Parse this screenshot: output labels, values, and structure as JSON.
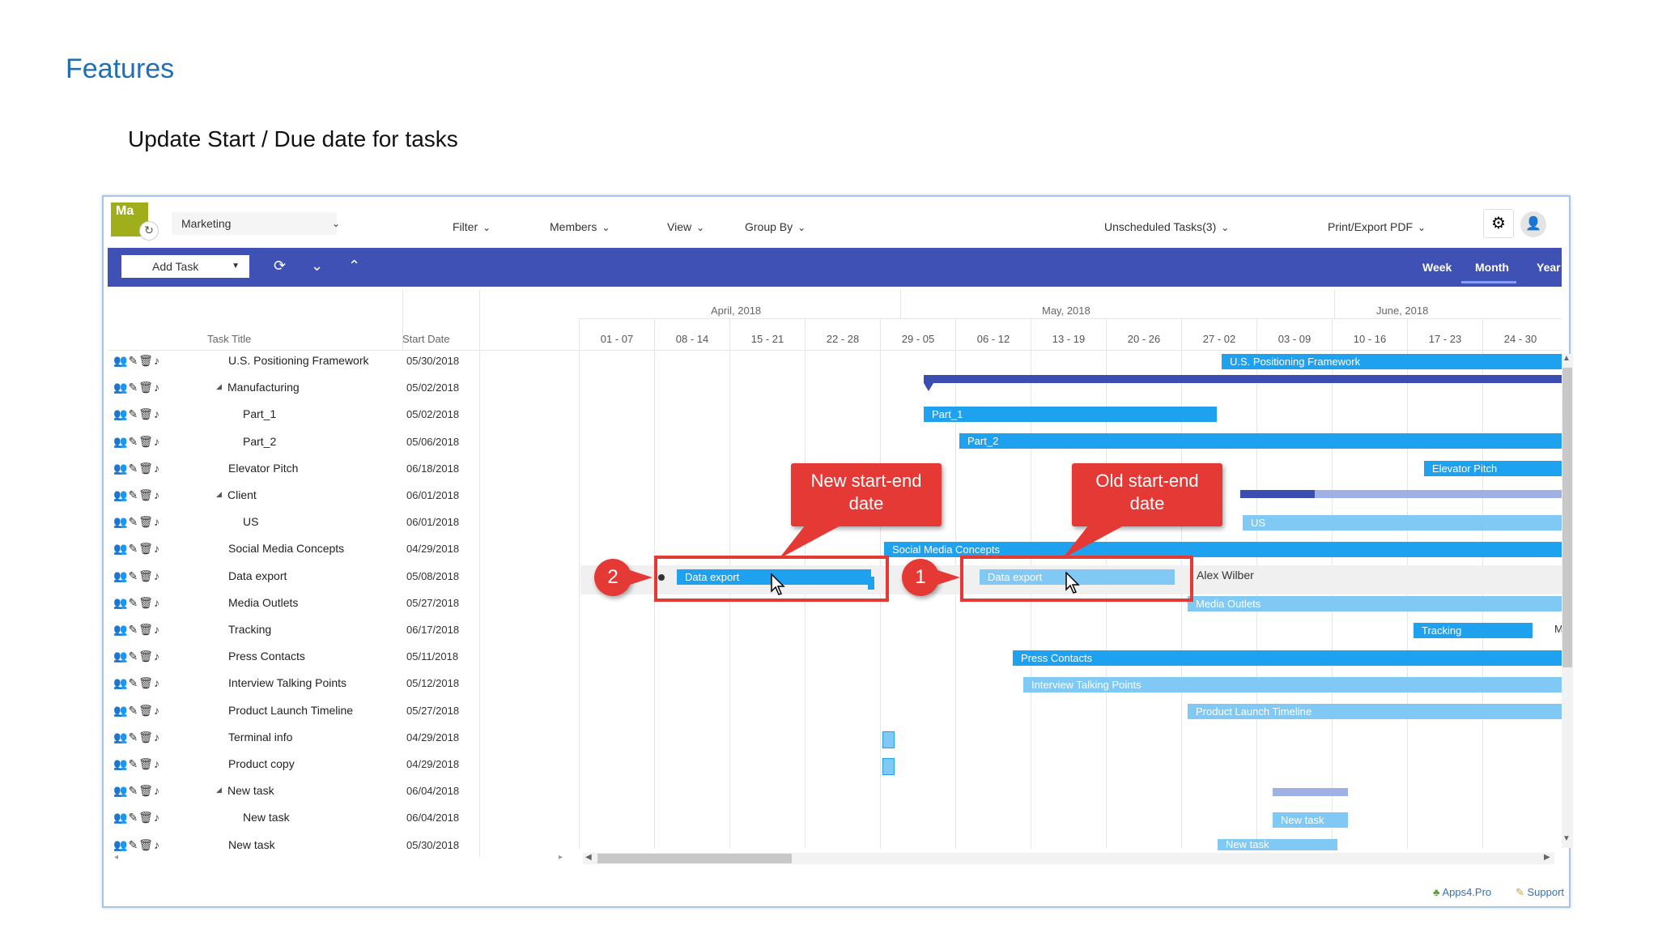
{
  "slide": {
    "title": "Features",
    "subtitle": "Update Start / Due date for tasks"
  },
  "app": {
    "logo_text": "Ma",
    "project": "Marketing",
    "toolbar": [
      "Filter",
      "Members",
      "View",
      "Group By"
    ],
    "unscheduled": "Unscheduled Tasks(3)",
    "print_export": "Print/Export PDF",
    "add_task": "Add Task",
    "views": [
      "Week",
      "Month",
      "Year"
    ],
    "active_view": "Month"
  },
  "grid": {
    "col_task_title": "Task Title",
    "col_start_date": "Start Date",
    "rows": [
      {
        "title": "U.S. Positioning Framework",
        "start": "05/30/2018",
        "indent": 0
      },
      {
        "title": "Manufacturing",
        "start": "05/02/2018",
        "indent": 0,
        "collapsible": "◢"
      },
      {
        "title": "Part_1",
        "start": "05/02/2018",
        "indent": 1
      },
      {
        "title": "Part_2",
        "start": "05/06/2018",
        "indent": 1
      },
      {
        "title": "Elevator Pitch",
        "start": "06/18/2018",
        "indent": 0
      },
      {
        "title": "Client",
        "start": "06/01/2018",
        "indent": 0,
        "collapsible": "◢"
      },
      {
        "title": "US",
        "start": "06/01/2018",
        "indent": 1
      },
      {
        "title": "Social Media Concepts",
        "start": "04/29/2018",
        "indent": 0
      },
      {
        "title": "Data export",
        "start": "05/08/2018",
        "indent": 0
      },
      {
        "title": "Media Outlets",
        "start": "05/27/2018",
        "indent": 0
      },
      {
        "title": "Tracking",
        "start": "06/17/2018",
        "indent": 0
      },
      {
        "title": "Press Contacts",
        "start": "05/11/2018",
        "indent": 0
      },
      {
        "title": "Interview Talking Points",
        "start": "05/12/2018",
        "indent": 0
      },
      {
        "title": "Product Launch Timeline",
        "start": "05/27/2018",
        "indent": 0
      },
      {
        "title": "Terminal info",
        "start": "04/29/2018",
        "indent": 0
      },
      {
        "title": "Product copy",
        "start": "04/29/2018",
        "indent": 0
      },
      {
        "title": "New task",
        "start": "06/04/2018",
        "indent": 0,
        "collapsible": "◢"
      },
      {
        "title": "New task",
        "start": "06/04/2018",
        "indent": 1
      },
      {
        "title": "New task",
        "start": "05/30/2018",
        "indent": 0
      }
    ]
  },
  "timeline": {
    "months": [
      "April, 2018",
      "May, 2018",
      "June, 2018"
    ],
    "weeks": [
      "01 - 07",
      "08 - 14",
      "15 - 21",
      "22 - 28",
      "29 - 05",
      "06 - 12",
      "13 - 19",
      "20 - 26",
      "27 - 02",
      "03 - 09",
      "10 - 16",
      "17 - 23",
      "24 - 30"
    ]
  },
  "bars": {
    "us_positioning": "U.S. Positioning Framework",
    "part1": "Part_1",
    "part2": "Part_2",
    "elevator": "Elevator Pitch",
    "us": "US",
    "social": "Social Media Concepts",
    "data_export_new": "Data export",
    "data_export_old": "Data export",
    "assignee": "Alex Wilber",
    "media": "Media Outlets",
    "tracking": "Tracking",
    "tracking_extra": "M",
    "press": "Press Contacts",
    "interview": "Interview Talking Points",
    "product_launch": "Product Launch Timeline",
    "new_task_child": "New task",
    "new_task_last": "New task"
  },
  "callouts": {
    "new": "New start-end date",
    "old": "Old start-end date",
    "badge1": "1",
    "badge2": "2"
  },
  "footer": {
    "apps": "Apps4.Pro",
    "support": "Support"
  },
  "colors": {
    "accent": "#3f51b5",
    "bar": "#1ea1ef",
    "callout": "#e53935"
  }
}
